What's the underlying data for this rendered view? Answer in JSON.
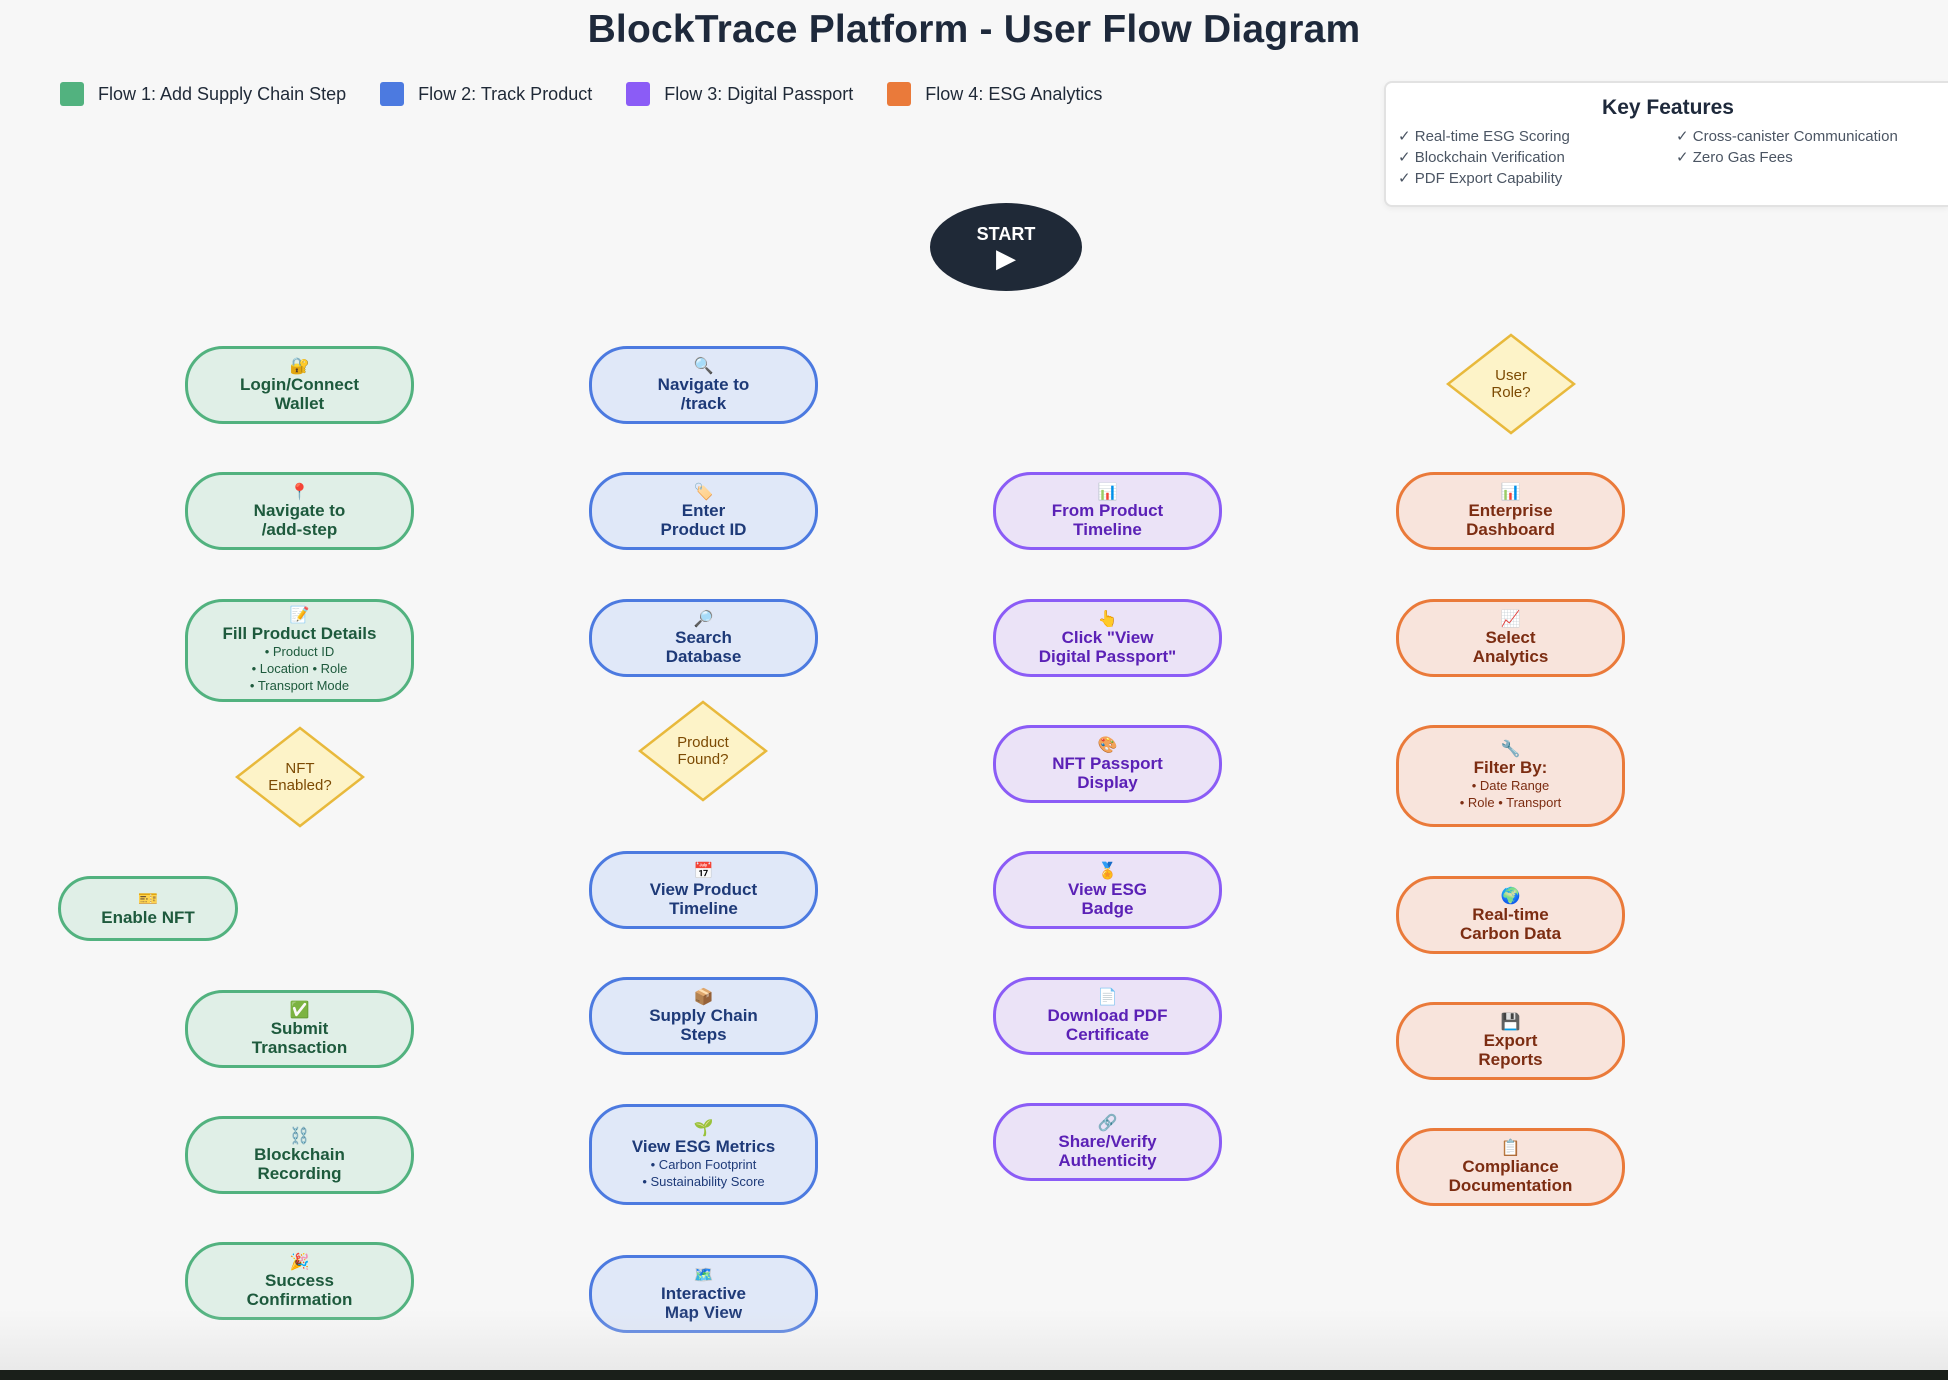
{
  "title": "BlockTrace Platform - User Flow Diagram",
  "legend": [
    {
      "label": "Flow 1: Add Supply Chain Step",
      "color": "#52b27f"
    },
    {
      "label": "Flow 2: Track Product",
      "color": "#4c7ae0"
    },
    {
      "label": "Flow 3: Digital Passport",
      "color": "#8b5cf6"
    },
    {
      "label": "Flow 4: ESG Analytics",
      "color": "#ea7a3a"
    }
  ],
  "key_features": {
    "title": "Key Features",
    "items": [
      "✓ Real-time ESG Scoring",
      "✓ Blockchain Verification",
      "✓ PDF Export Capability",
      "✓ Cross-canister Communication",
      "✓ Zero Gas Fees"
    ]
  },
  "start": {
    "label": "START",
    "icon": "▶"
  },
  "flow1": {
    "login": {
      "icon": "🔐",
      "label": "Login/Connect\nWallet"
    },
    "navigate": {
      "icon": "📍",
      "label": "Navigate to\n/add-step"
    },
    "fill": {
      "icon": "📝",
      "label": "Fill Product Details",
      "sub": "• Product ID\n• Location • Role\n• Transport Mode"
    },
    "decision": "NFT\nEnabled?",
    "enable_nft": {
      "icon": "🎫",
      "label": "Enable NFT"
    },
    "submit": {
      "icon": "✅",
      "label": "Submit\nTransaction"
    },
    "blockchain": {
      "icon": "⛓️",
      "label": "Blockchain\nRecording"
    },
    "success": {
      "icon": "🎉",
      "label": "Success\nConfirmation"
    }
  },
  "flow2": {
    "navigate": {
      "icon": "🔍",
      "label": "Navigate to\n/track"
    },
    "enter": {
      "icon": "🏷️",
      "label": "Enter\nProduct ID"
    },
    "search": {
      "icon": "🔎",
      "label": "Search\nDatabase"
    },
    "decision": "Product\nFound?",
    "timeline": {
      "icon": "📅",
      "label": "View Product\nTimeline"
    },
    "steps": {
      "icon": "📦",
      "label": "Supply Chain\nSteps"
    },
    "esg": {
      "icon": "🌱",
      "label": "View ESG Metrics",
      "sub": "• Carbon Footprint\n• Sustainability Score"
    },
    "map": {
      "icon": "🗺️",
      "label": "Interactive\nMap View"
    }
  },
  "flow3": {
    "from_timeline": {
      "icon": "📊",
      "label": "From Product\nTimeline"
    },
    "click_passport": {
      "icon": "👆",
      "label": "Click \"View\nDigital Passport\""
    },
    "nft_display": {
      "icon": "🎨",
      "label": "NFT Passport\nDisplay"
    },
    "esg_badge": {
      "icon": "🏅",
      "label": "View ESG\nBadge"
    },
    "download": {
      "icon": "📄",
      "label": "Download PDF\nCertificate"
    },
    "share": {
      "icon": "🔗",
      "label": "Share/Verify\nAuthenticity"
    }
  },
  "flow4": {
    "decision": "User\nRole?",
    "dashboard": {
      "icon": "📊",
      "label": "Enterprise\nDashboard"
    },
    "analytics": {
      "icon": "📈",
      "label": "Select\nAnalytics"
    },
    "filter": {
      "icon": "🔧",
      "label": "Filter By:",
      "sub": "• Date Range\n• Role • Transport"
    },
    "carbon": {
      "icon": "🌍",
      "label": "Real-time\nCarbon Data"
    },
    "export": {
      "icon": "💾",
      "label": "Export\nReports"
    },
    "compliance": {
      "icon": "📋",
      "label": "Compliance\nDocumentation"
    }
  }
}
